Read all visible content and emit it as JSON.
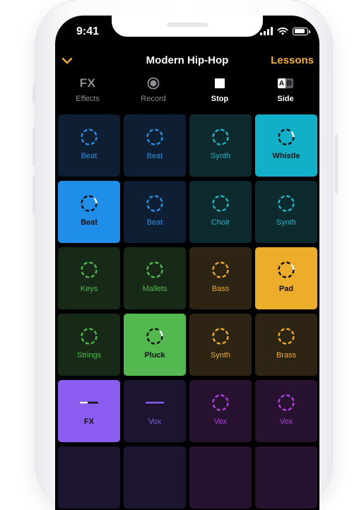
{
  "status_bar": {
    "time": "9:41"
  },
  "nav": {
    "title": "Modern Hip-Hop",
    "lessons_label": "Lessons"
  },
  "toolbar": [
    {
      "key": "effects",
      "glyph": "FX",
      "label": "Effects",
      "active": false
    },
    {
      "key": "record",
      "label": "Record",
      "active": false
    },
    {
      "key": "stop",
      "label": "Stop",
      "active": true
    },
    {
      "key": "side",
      "glyph_a": "A",
      "glyph_b": "B",
      "label": "Side",
      "active": true
    }
  ],
  "colors": {
    "accent": "#f1b12f",
    "blue_dark": "#0f1f33",
    "blue_text": "#2a8ee0",
    "blue_lit": "#1f8ee8",
    "teal_dark": "#0d2a2e",
    "teal_text": "#1fb5c9",
    "teal_lit": "#12b0c8",
    "green_dark": "#172917",
    "green_text": "#53b84f",
    "green_lit": "#53b84f",
    "gold_dark": "#2e2413",
    "gold_text": "#ecac28",
    "gold_lit": "#ecad2b",
    "purple_dark": "#1d1530",
    "purple_text": "#8b5cf0",
    "purple_lit": "#8b5cf0",
    "magenta_dark": "#271230",
    "magenta_text": "#b340e2"
  },
  "pads": [
    [
      {
        "label": "Beat",
        "group": "blue",
        "lit": false,
        "icon": "loop-icon"
      },
      {
        "label": "Beat",
        "group": "blue",
        "lit": false,
        "icon": "loop-icon"
      },
      {
        "label": "Synth",
        "group": "teal",
        "lit": false,
        "icon": "loop-icon"
      },
      {
        "label": "Whistle",
        "group": "teal",
        "lit": true,
        "icon": "loop-icon"
      }
    ],
    [
      {
        "label": "Beat",
        "group": "blue",
        "lit": true,
        "icon": "loop-icon"
      },
      {
        "label": "Beat",
        "group": "blue",
        "lit": false,
        "icon": "loop-icon"
      },
      {
        "label": "Choir",
        "group": "teal",
        "lit": false,
        "icon": "loop-icon"
      },
      {
        "label": "Synth",
        "group": "teal",
        "lit": false,
        "icon": "loop-icon"
      }
    ],
    [
      {
        "label": "Keys",
        "group": "green",
        "lit": false,
        "icon": "loop-icon"
      },
      {
        "label": "Mallets",
        "group": "green",
        "lit": false,
        "icon": "loop-icon"
      },
      {
        "label": "Bass",
        "group": "gold",
        "lit": false,
        "icon": "loop-icon"
      },
      {
        "label": "Pad",
        "group": "gold",
        "lit": true,
        "icon": "loop-icon"
      }
    ],
    [
      {
        "label": "Strings",
        "group": "green",
        "lit": false,
        "icon": "loop-icon"
      },
      {
        "label": "Pluck",
        "group": "green",
        "lit": true,
        "icon": "loop-icon"
      },
      {
        "label": "Synth",
        "group": "gold",
        "lit": false,
        "icon": "loop-icon"
      },
      {
        "label": "Brass",
        "group": "gold",
        "lit": false,
        "icon": "loop-icon"
      }
    ],
    [
      {
        "label": "FX",
        "group": "purple",
        "lit": true,
        "icon": "one-shot-icon"
      },
      {
        "label": "Vox",
        "group": "purple",
        "lit": false,
        "icon": "one-shot-icon"
      },
      {
        "label": "Vox",
        "group": "magenta",
        "lit": false,
        "icon": "loop-icon"
      },
      {
        "label": "Vox",
        "group": "magenta",
        "lit": false,
        "icon": "loop-icon"
      }
    ],
    [
      {
        "label": "",
        "group": "purple",
        "lit": false,
        "icon": ""
      },
      {
        "label": "",
        "group": "purple",
        "lit": false,
        "icon": ""
      },
      {
        "label": "",
        "group": "magenta",
        "lit": false,
        "icon": ""
      },
      {
        "label": "",
        "group": "magenta",
        "lit": false,
        "icon": ""
      }
    ]
  ]
}
